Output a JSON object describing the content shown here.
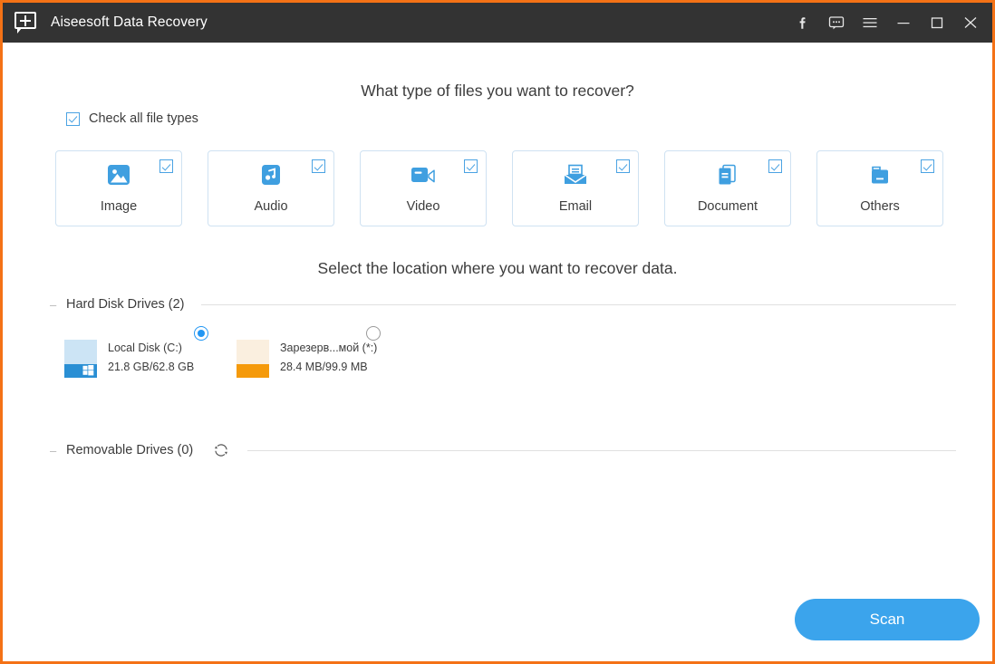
{
  "window": {
    "border_color": "#f47216",
    "titlebar_bg": "#333333",
    "accent_color": "#3ba4ec"
  },
  "titlebar": {
    "logo_icon": "app-add-screen-icon",
    "title": "Aiseesoft Data Recovery",
    "controls": [
      {
        "name": "facebook-icon",
        "glyph": "f"
      },
      {
        "name": "feedback-chat-icon",
        "glyph": "chat"
      },
      {
        "name": "menu-icon",
        "glyph": "hamburger"
      },
      {
        "name": "minimize-icon",
        "glyph": "minimize"
      },
      {
        "name": "maximize-icon",
        "glyph": "maximize"
      },
      {
        "name": "close-icon",
        "glyph": "close"
      }
    ]
  },
  "filetypes": {
    "heading": "What type of files you want to recover?",
    "check_all_label": "Check all file types",
    "check_all_checked": true,
    "cards": [
      {
        "label": "Image",
        "icon": "image-icon",
        "checked": true
      },
      {
        "label": "Audio",
        "icon": "audio-icon",
        "checked": true
      },
      {
        "label": "Video",
        "icon": "video-icon",
        "checked": true
      },
      {
        "label": "Email",
        "icon": "email-icon",
        "checked": true
      },
      {
        "label": "Document",
        "icon": "document-icon",
        "checked": true
      },
      {
        "label": "Others",
        "icon": "others-icon",
        "checked": true
      }
    ]
  },
  "location": {
    "heading": "Select the location where you want to recover data.",
    "hard_disk_group_title": "Hard Disk Drives (2)",
    "removable_group_title": "Removable Drives (0)",
    "refresh_icon": "refresh-icon",
    "drives": [
      {
        "name": "Local Disk (C:)",
        "size": "21.8 GB/62.8 GB",
        "selected": true,
        "icon_top_color": "#cce4f5",
        "icon_bottom_color": "#2a8fd4",
        "has_windows_logo": true
      },
      {
        "name": "Зарезерв...мой (*:)",
        "size": "28.4 MB/99.9 MB",
        "selected": false,
        "icon_top_color": "#faefdf",
        "icon_bottom_color": "#f59a0b",
        "has_windows_logo": false
      }
    ]
  },
  "footer": {
    "scan_label": "Scan"
  }
}
